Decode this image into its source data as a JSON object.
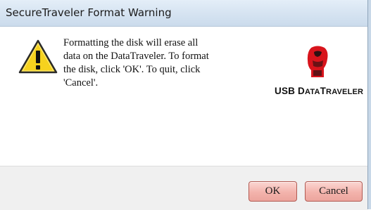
{
  "window": {
    "title": "SecureTraveler Format Warning"
  },
  "dialog": {
    "message": "Formatting the disk will erase all\ndata on the DataTraveler.  To format\nthe disk, click 'OK'.  To quit, click\n'Cancel'.",
    "icon": "warning-triangle-icon",
    "logo_text": "USB DataTraveler",
    "logo_icon": "kingston-head-logo-icon"
  },
  "buttons": {
    "ok_label": "OK",
    "cancel_label": "Cancel"
  },
  "colors": {
    "titlebar": "#d5e3f1",
    "button_fill": "#f3b3ac",
    "button_border": "#b25a52",
    "logo_red": "#d8141c",
    "warning_yellow": "#f6d21e"
  }
}
